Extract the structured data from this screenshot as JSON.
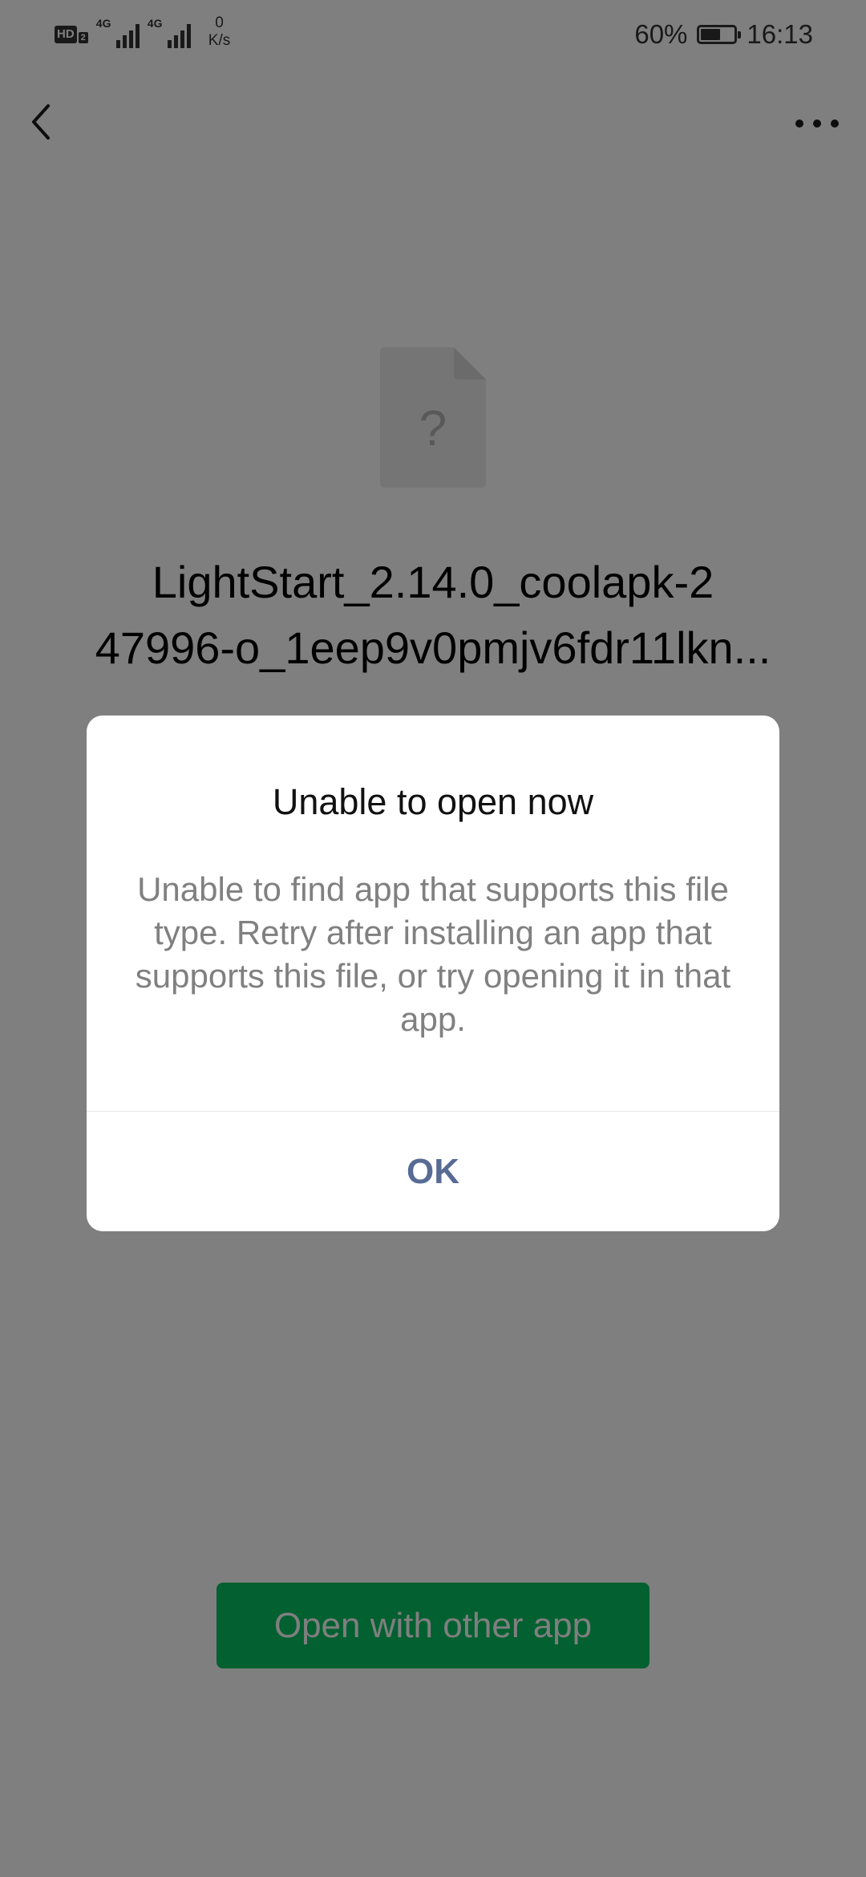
{
  "status_bar": {
    "hd_label": "HD",
    "hd_sub": "2",
    "signal_1": "4G",
    "signal_2": "4G",
    "speed_value": "0",
    "speed_unit": "K/s",
    "battery_percent": "60%",
    "battery_level": 0.6,
    "time": "16:13"
  },
  "app_bar": {
    "back_icon": "chevron-left-icon",
    "more_icon": "more-horizontal-icon"
  },
  "file": {
    "icon": "unknown-file-icon",
    "icon_glyph": "?",
    "name_line1": "LightStart_2.14.0_coolapk-2",
    "name_line2": "47996-o_1eep9v0pmjv6fdr11lkn..."
  },
  "actions": {
    "open_with_label": "Open with other app"
  },
  "dialog": {
    "title": "Unable to open now",
    "message": "Unable to find app that supports this file type. Retry after installing an app that supports this file, or try opening it in that app.",
    "ok_label": "OK"
  },
  "colors": {
    "accent_green": "#07c160",
    "dialog_button": "#576b95",
    "overlay": "rgba(0,0,0,0.5)"
  }
}
